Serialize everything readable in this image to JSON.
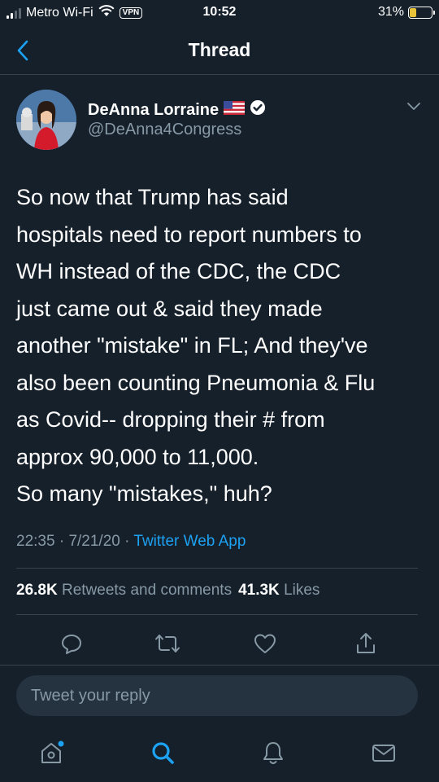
{
  "status_bar": {
    "carrier": "Metro Wi-Fi",
    "vpn": "VPN",
    "time": "10:52",
    "battery": "31%",
    "battery_level": 0.31
  },
  "header": {
    "title": "Thread"
  },
  "tweet": {
    "author_name": "DeAnna Lorraine",
    "handle": "@DeAnna4Congress",
    "text": "So now that Trump has said\nhospitals need to report numbers to\nWH instead of the CDC, the CDC\njust came out & said they made\nanother \"mistake\" in FL; And they've\nalso been counting Pneumonia & Flu\nas Covid-- dropping their # from\napprox 90,000 to 11,000.\nSo many \"mistakes,\" huh?",
    "time": "22:35",
    "date": "7/21/20",
    "source": "Twitter Web App",
    "retweets_count": "26.8K",
    "retweets_label": "Retweets and comments",
    "likes_count": "41.3K",
    "likes_label": "Likes"
  },
  "reply": {
    "placeholder": "Tweet your reply"
  },
  "colors": {
    "background": "#15202b",
    "accent": "#1da1f2",
    "muted": "#8899a6",
    "divider": "#38444d"
  }
}
